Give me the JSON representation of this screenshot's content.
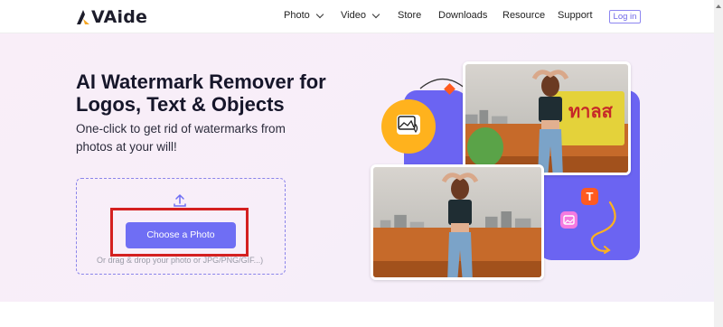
{
  "header": {
    "logo_text": "VAide",
    "nav": [
      {
        "label": "Photo",
        "has_dropdown": true
      },
      {
        "label": "Video",
        "has_dropdown": true
      },
      {
        "label": "Store",
        "has_dropdown": false
      },
      {
        "label": "Downloads",
        "has_dropdown": false
      },
      {
        "label": "Resource",
        "has_dropdown": false
      },
      {
        "label": "Support",
        "has_dropdown": false
      }
    ],
    "login_label": "Log in"
  },
  "hero": {
    "title": "AI Watermark Remover for Logos, Text & Objects",
    "subtitle": "One-click to get rid of watermarks from photos at your will!",
    "upload": {
      "button_label": "Choose a Photo",
      "hint": "Or drag & drop your photo or JPG/PNG/GIF...)"
    },
    "illustration": {
      "sign_text": "ทาลส"
    }
  },
  "colors": {
    "accent": "#6f6ef4",
    "highlight_box": "#d42020",
    "brand_purple": "#6b64f2",
    "badge_orange": "#ffb21d"
  }
}
